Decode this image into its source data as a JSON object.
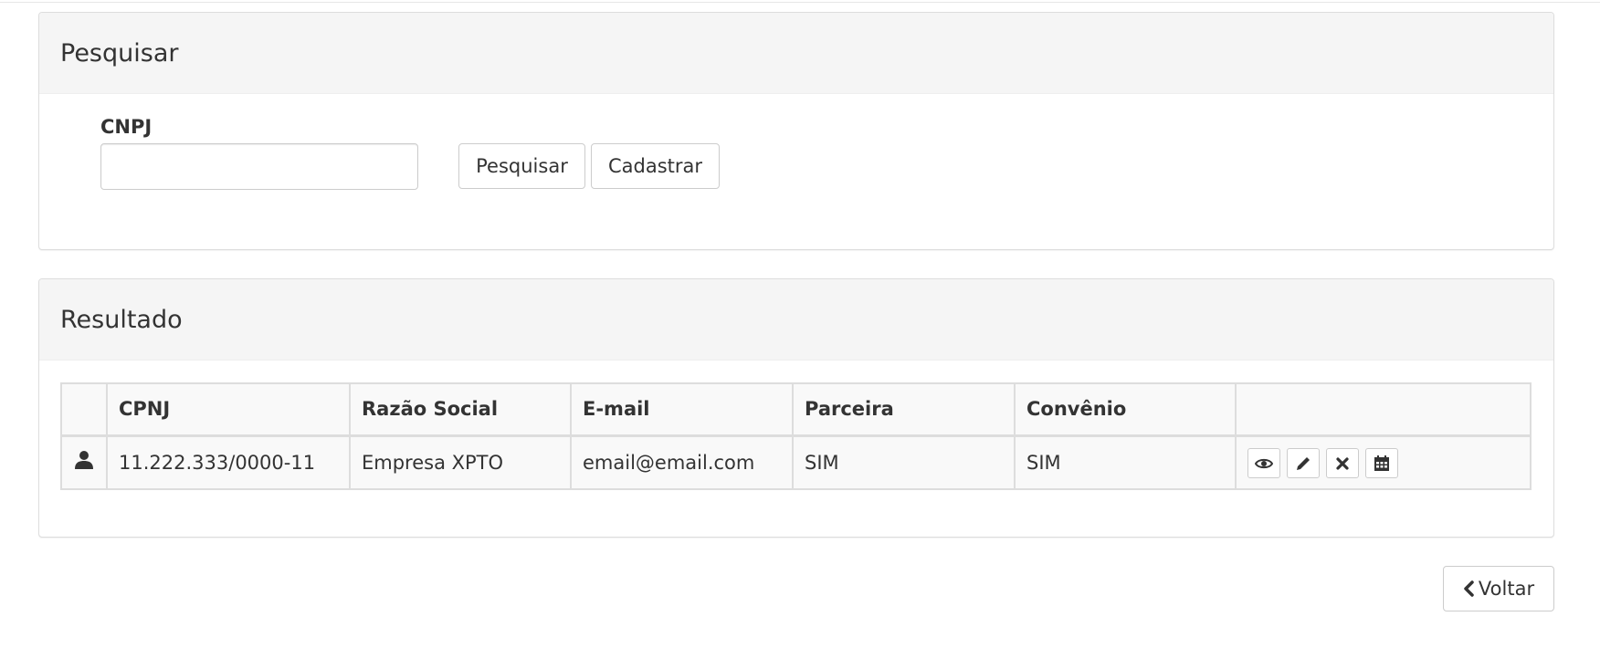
{
  "search_panel": {
    "title": "Pesquisar",
    "cnpj_label": "CNPJ",
    "cnpj_value": "",
    "search_button": "Pesquisar",
    "register_button": "Cadastrar"
  },
  "result_panel": {
    "title": "Resultado",
    "columns": [
      "CPNJ",
      "Razão Social",
      "E-mail",
      "Parceira",
      "Convênio"
    ],
    "rows": [
      {
        "icon": "user-icon",
        "cpnj": "11.222.333/0000-11",
        "razao_social": "Empresa XPTO",
        "email": "email@email.com",
        "parceira": "SIM",
        "convenio": "SIM",
        "actions": [
          "eye-icon",
          "pencil-icon",
          "close-icon",
          "calendar-icon"
        ]
      }
    ]
  },
  "footer": {
    "back_button": "Voltar",
    "back_icon": "chevron-left-icon"
  },
  "colors": {
    "panel_heading_bg": "#f5f5f5",
    "border": "#dddddd",
    "text": "#333333"
  }
}
